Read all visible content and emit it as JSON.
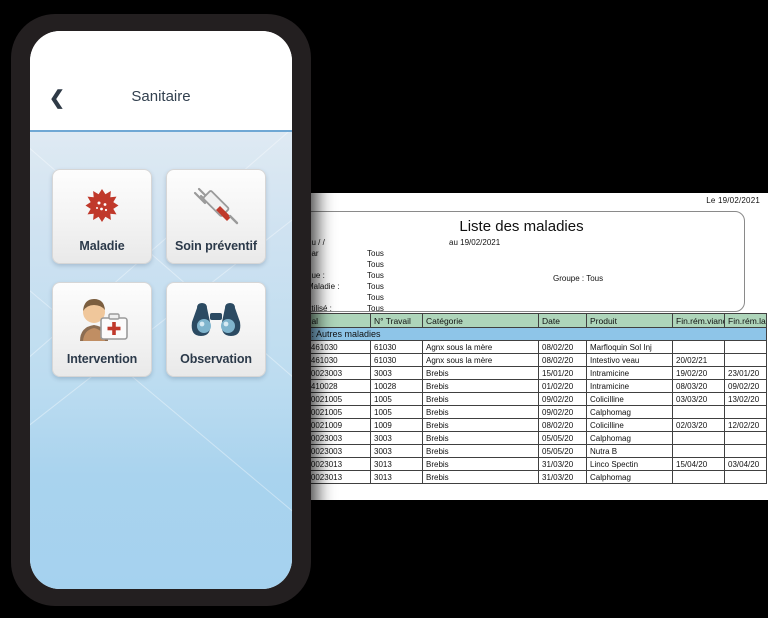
{
  "phone": {
    "back_icon": "chevron-left-icon",
    "title": "Sanitaire",
    "tiles": [
      {
        "label": "Maladie",
        "icon": "virus-icon"
      },
      {
        "label": "Soin préventif",
        "icon": "syringe-icon"
      },
      {
        "label": "Intervention",
        "icon": "medic-first-aid-icon"
      },
      {
        "label": "Observation",
        "icon": "binoculars-icon"
      }
    ]
  },
  "report": {
    "date_line": "Le  19/02/2021",
    "title": "Liste des maladies",
    "criteria": [
      {
        "label": " du  / /",
        "value": "",
        "extra": "au   19/02/2021"
      },
      {
        "label": "par",
        "value": "Tous",
        "extra": ""
      },
      {
        "label": "",
        "value": "Tous",
        "extra": ""
      },
      {
        "label": "que :",
        "value": "Tous",
        "extra": ""
      },
      {
        "label": "Maladie :",
        "value": "Tous",
        "extra": ""
      },
      {
        "label": ":",
        "value": "Tous",
        "extra": ""
      },
      {
        "label": "utilisé :",
        "value": "Tous",
        "extra": ""
      }
    ],
    "groupe_line": "Groupe : Tous",
    "table": {
      "columns": [
        "onal",
        "N° Travail",
        "Catégorie",
        "Date",
        "Produit",
        "Fin.rém.viand",
        "Fin.rém.lait"
      ],
      "group_label": "ie : Autres maladies",
      "rows": [
        [
          "42461030",
          "61030",
          "Agnx sous la mère",
          "08/02/20",
          "Marfloquin Sol Inj",
          "",
          ""
        ],
        [
          "42461030",
          "61030",
          "Agnx sous la mère",
          "08/02/20",
          "Intestivo veau",
          "20/02/21",
          ""
        ],
        [
          "360023003",
          "3003",
          "Brebis",
          "15/01/20",
          "Intramicine",
          "19/02/20",
          "23/01/20"
        ],
        [
          "42410028",
          "10028",
          "Brebis",
          "01/02/20",
          "Intramicine",
          "08/03/20",
          "09/02/20"
        ],
        [
          "360021005",
          "1005",
          "Brebis",
          "09/02/20",
          "Colicilline",
          "03/03/20",
          "13/02/20"
        ],
        [
          "360021005",
          "1005",
          "Brebis",
          "09/02/20",
          "Calphomag",
          "",
          ""
        ],
        [
          "360021009",
          "1009",
          "Brebis",
          "08/02/20",
          "Colicilline",
          "02/03/20",
          "12/02/20"
        ],
        [
          "360023003",
          "3003",
          "Brebis",
          "05/05/20",
          "Calphomag",
          "",
          ""
        ],
        [
          "360023003",
          "3003",
          "Brebis",
          "05/05/20",
          "Nutra B",
          "",
          ""
        ],
        [
          "360023013",
          "3013",
          "Brebis",
          "31/03/20",
          "Linco Spectin",
          "15/04/20",
          "03/04/20"
        ],
        [
          "360023013",
          "3013",
          "Brebis",
          "31/03/20",
          "Calphomag",
          "",
          ""
        ]
      ]
    }
  },
  "colors": {
    "header_green": "#aed5ba",
    "group_blue": "#8ec5e8",
    "phone_frame": "#231f20",
    "accent_blue": "#6fa8d4",
    "title_text": "#32404f"
  }
}
